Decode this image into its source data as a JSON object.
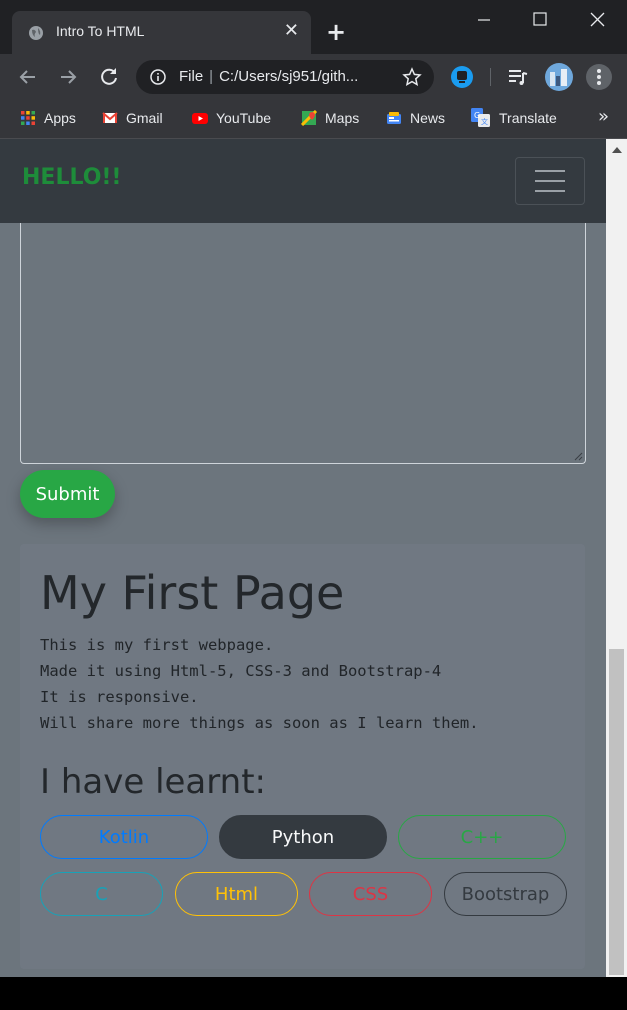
{
  "browser": {
    "tab_title": "Intro To HTML",
    "tab_close": "✕",
    "new_tab": "+",
    "address_scheme": "File",
    "address_path": "C:/Users/sj951/gith...",
    "bookmarks": [
      {
        "label": "Apps",
        "icon": "apps-grid-icon"
      },
      {
        "label": "Gmail",
        "icon": "gmail-icon"
      },
      {
        "label": "YouTube",
        "icon": "youtube-icon"
      },
      {
        "label": "Maps",
        "icon": "maps-icon"
      },
      {
        "label": "News",
        "icon": "news-icon"
      },
      {
        "label": "Translate",
        "icon": "translate-icon"
      }
    ],
    "bookmarks_more": "»"
  },
  "page": {
    "brand": "HELLO!!",
    "submit_label": "Submit",
    "heading": "My First Page",
    "intro_lines": "This is my first webpage.\nMade it using Html-5, CSS-3 and Bootstrap-4\nIt is responsive.\nWill share more things as soon as I learn them.",
    "learnt_heading": "I have learnt:",
    "skills": [
      {
        "label": "Kotlin",
        "style": "outline-primary",
        "color": "#007bff"
      },
      {
        "label": "Python",
        "style": "solid-dark",
        "color": "#343a40"
      },
      {
        "label": "C++",
        "style": "outline-success",
        "color": "#28a745"
      },
      {
        "label": "C",
        "style": "outline-info",
        "color": "#17a2b8"
      },
      {
        "label": "Html",
        "style": "outline-warning",
        "color": "#ffc107"
      },
      {
        "label": "CSS",
        "style": "outline-danger",
        "color": "#dc3545"
      },
      {
        "label": "Bootstrap",
        "style": "outline-dark",
        "color": "#343a40"
      }
    ]
  },
  "colors": {
    "navbar_bg": "#343a40",
    "page_bg": "#6c757d",
    "brand": "#1e8c3a",
    "submit_bg": "#28a745"
  }
}
